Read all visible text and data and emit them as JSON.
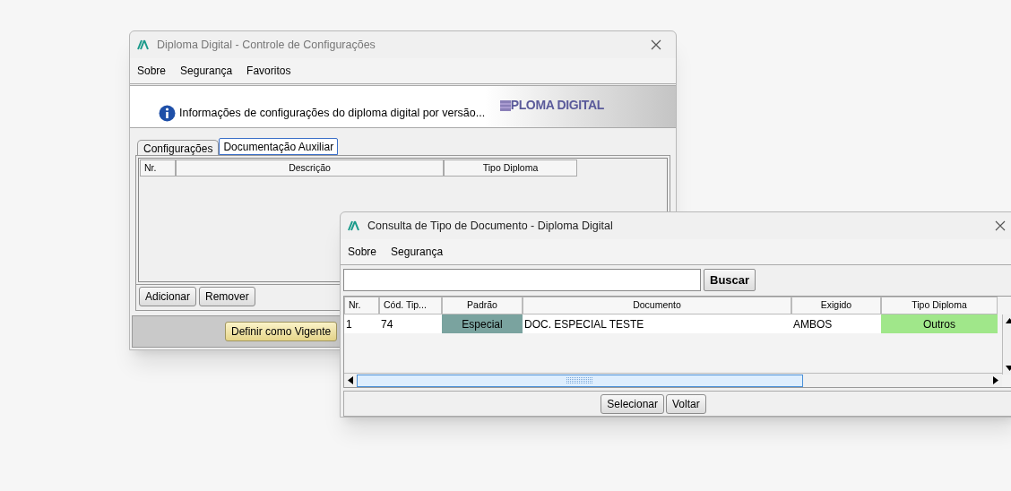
{
  "main_window": {
    "title": "Diploma Digital - Controle de Configurações",
    "menu": [
      "Sobre",
      "Segurança",
      "Favoritos"
    ],
    "banner": {
      "text": "Informações de configurações do diploma digital por versão...",
      "logo": "PLOMA DIGITAL"
    },
    "tabs": [
      {
        "label": "Configurações",
        "selected": false
      },
      {
        "label": "Documentação Auxiliar",
        "selected": true
      }
    ],
    "table": {
      "columns": [
        "Nr.",
        "Descrição",
        "Tipo Diploma"
      ]
    },
    "buttons": [
      "Adicionar",
      "Remover"
    ],
    "footer_button": "Definir como Vigente"
  },
  "dialog": {
    "title": "Consulta de Tipo de Documento - Diploma Digital",
    "menu": [
      "Sobre",
      "Segurança"
    ],
    "search": {
      "button": "Buscar"
    },
    "table": {
      "columns": [
        "Nr.",
        "Cód. Tip...",
        "Padrão",
        "Documento",
        "Exigido",
        "Tipo Diploma"
      ],
      "rows": [
        {
          "cells": [
            {
              "text": "1"
            },
            {
              "text": "74"
            },
            {
              "text": "Especial",
              "color": "#7aa39f"
            },
            {
              "text": "DOC. ESPECIAL TESTE"
            },
            {
              "text": "AMBOS"
            },
            {
              "text": "Outros",
              "color": "#a0e78a"
            }
          ]
        }
      ]
    },
    "buttons": [
      "Selecionar",
      "Voltar"
    ]
  }
}
